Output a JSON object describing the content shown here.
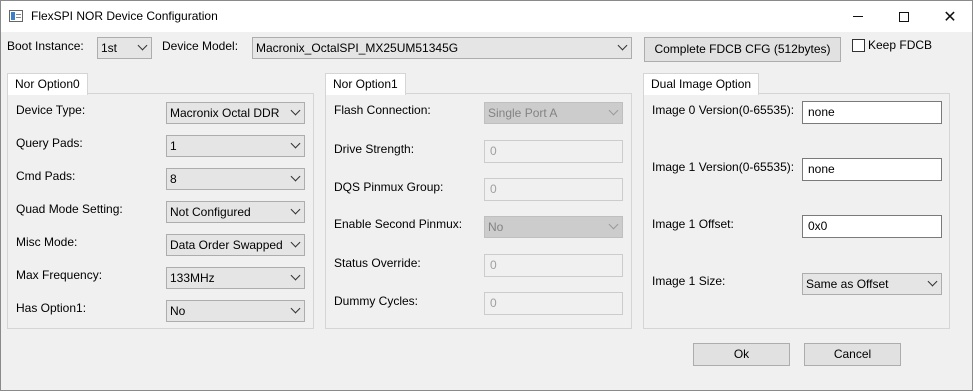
{
  "window": {
    "title": "FlexSPI NOR Device Configuration",
    "icon": "app-window-icon",
    "controls": {
      "minimize": "",
      "maximize": "",
      "close": "✕"
    }
  },
  "toolbar": {
    "boot_instance_label": "Boot Instance:",
    "boot_instance_value": "1st",
    "device_model_label": "Device Model:",
    "device_model_value": "Macronix_OctalSPI_MX25UM51345G",
    "complete_fdcb_button": "Complete FDCB CFG (512bytes)",
    "keep_fdcb_label": "Keep FDCB",
    "keep_fdcb_checked": false
  },
  "nor_option0": {
    "tab_label": "Nor Option0",
    "fields": [
      {
        "label": "Device Type:",
        "value": "Macronix Octal DDR"
      },
      {
        "label": "Query Pads:",
        "value": "1"
      },
      {
        "label": "Cmd Pads:",
        "value": "8"
      },
      {
        "label": "Quad Mode Setting:",
        "value": "Not Configured"
      },
      {
        "label": "Misc Mode:",
        "value": "Data Order Swapped"
      },
      {
        "label": "Max Frequency:",
        "value": "133MHz"
      },
      {
        "label": "Has Option1:",
        "value": "No"
      }
    ]
  },
  "nor_option1": {
    "tab_label": "Nor Option1",
    "fields": [
      {
        "label": "Flash Connection:",
        "value": "Single Port A",
        "kind": "combo"
      },
      {
        "label": "Drive Strength:",
        "value": "0",
        "kind": "text"
      },
      {
        "label": "DQS Pinmux Group:",
        "value": "0",
        "kind": "text"
      },
      {
        "label": "Enable Second Pinmux:",
        "value": "No",
        "kind": "combo"
      },
      {
        "label": "Status Override:",
        "value": "0",
        "kind": "text"
      },
      {
        "label": "Dummy Cycles:",
        "value": "0",
        "kind": "text"
      }
    ]
  },
  "dual_image": {
    "tab_label": "Dual Image Option",
    "fields": [
      {
        "label": "Image 0 Version(0-65535):",
        "value": "none",
        "kind": "text"
      },
      {
        "label": "Image 1 Version(0-65535):",
        "value": "none",
        "kind": "text"
      },
      {
        "label": "Image 1 Offset:",
        "value": "0x0",
        "kind": "text"
      },
      {
        "label": "Image 1 Size:",
        "value": "Same as Offset",
        "kind": "combo"
      }
    ]
  },
  "footer": {
    "ok_button": "Ok",
    "cancel_button": "Cancel"
  }
}
